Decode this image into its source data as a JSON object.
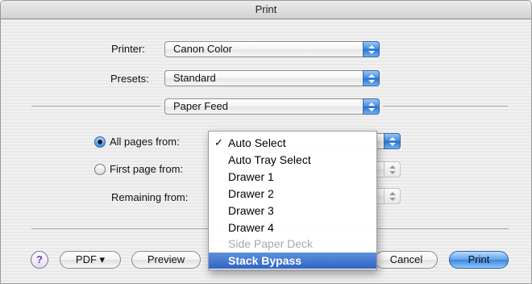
{
  "window": {
    "title": "Print"
  },
  "printer": {
    "label": "Printer:",
    "value": "Canon Color"
  },
  "presets": {
    "label": "Presets:",
    "value": "Standard"
  },
  "panel": {
    "value": "Paper Feed"
  },
  "paper_feed": {
    "all_pages_label": "All pages from:",
    "first_page_label": "First page from:",
    "remaining_label": "Remaining from:",
    "all_pages_selected": true
  },
  "tray_menu": {
    "checked_item": "Auto Select",
    "items": [
      {
        "label": "Auto Select",
        "checked": true,
        "enabled": true,
        "highlighted": false
      },
      {
        "label": "Auto Tray Select",
        "checked": false,
        "enabled": true,
        "highlighted": false
      },
      {
        "label": "Drawer 1",
        "checked": false,
        "enabled": true,
        "highlighted": false
      },
      {
        "label": "Drawer 2",
        "checked": false,
        "enabled": true,
        "highlighted": false
      },
      {
        "label": "Drawer 3",
        "checked": false,
        "enabled": true,
        "highlighted": false
      },
      {
        "label": "Drawer 4",
        "checked": false,
        "enabled": true,
        "highlighted": false
      },
      {
        "label": "Side Paper Deck",
        "checked": false,
        "enabled": false,
        "highlighted": false
      },
      {
        "label": "Stack Bypass",
        "checked": false,
        "enabled": true,
        "highlighted": true
      }
    ]
  },
  "footer": {
    "help_label": "?",
    "pdf_label": "PDF ▾",
    "preview_label": "Preview",
    "cancel_label": "Cancel",
    "print_label": "Print"
  },
  "colors": {
    "accent": "#3b8ae0",
    "highlight": "#2f66c4"
  },
  "icons": {
    "popup_arrows": "up-down-arrows-icon",
    "check": "checkmark-icon"
  }
}
